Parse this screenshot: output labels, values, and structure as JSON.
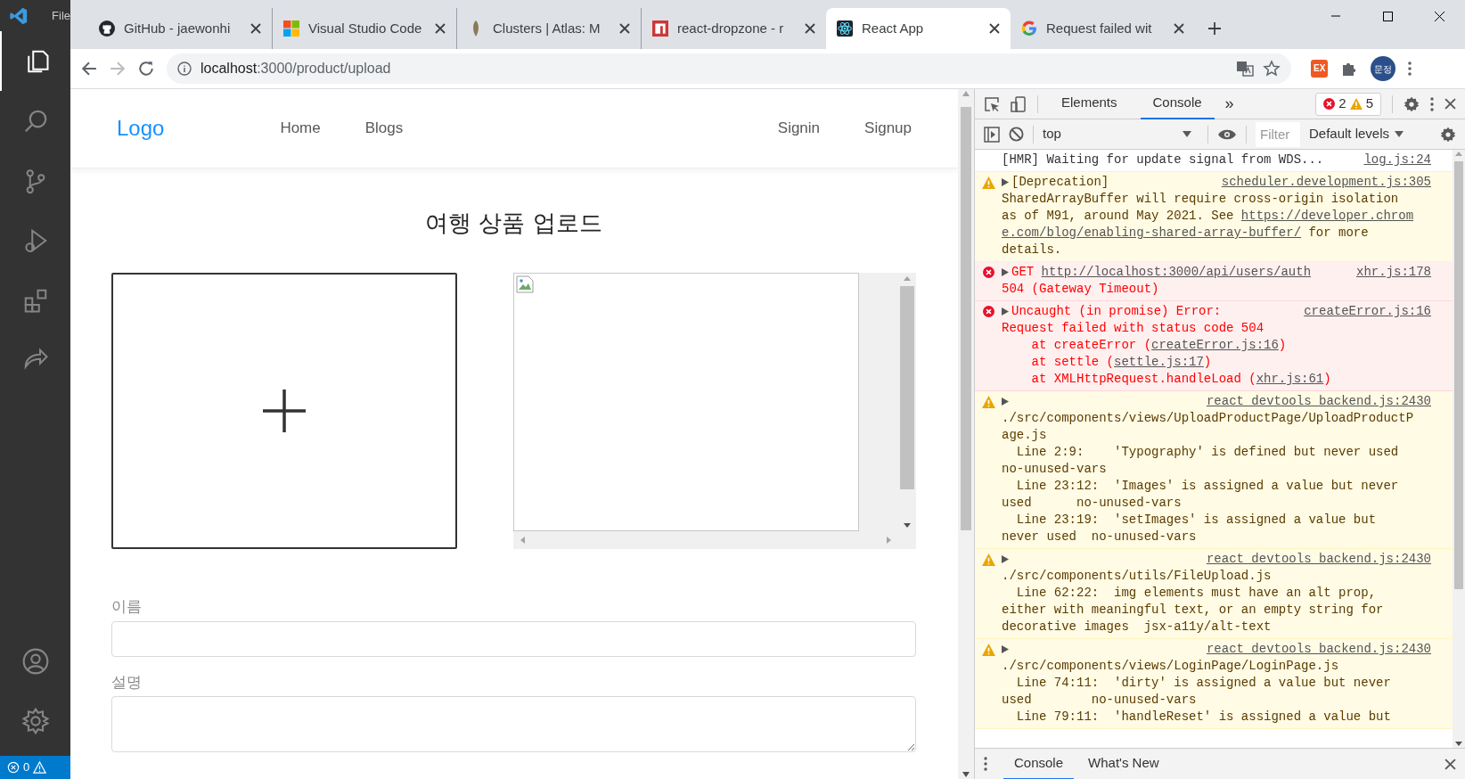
{
  "vscode": {
    "menu_label": "File",
    "status_errors": "0"
  },
  "browser": {
    "tabs": [
      {
        "title": "GitHub - jaewonhi",
        "kind": "github",
        "selected": false
      },
      {
        "title": "Visual Studio Code",
        "kind": "windows",
        "selected": false
      },
      {
        "title": "Clusters | Atlas: M",
        "kind": "leaf",
        "selected": false
      },
      {
        "title": "react-dropzone - r",
        "kind": "npm",
        "selected": false
      },
      {
        "title": "React App",
        "kind": "react",
        "selected": true
      },
      {
        "title": "Request failed wit",
        "kind": "google",
        "selected": false
      }
    ],
    "address_host": "localhost",
    "address_path": ":3000/product/upload",
    "extension_label": "EX",
    "avatar_label": "문정"
  },
  "page": {
    "nav": {
      "logo": "Logo",
      "links": [
        "Home",
        "Blogs"
      ],
      "auth_links": [
        "Signin",
        "Signup"
      ]
    },
    "title": "여행 상품 업로드",
    "fields": [
      {
        "label": "이름",
        "kind": "input"
      },
      {
        "label": "설명",
        "kind": "textarea"
      }
    ]
  },
  "devtools": {
    "tabs": [
      {
        "label": "Elements",
        "selected": false
      },
      {
        "label": "Console",
        "selected": true
      }
    ],
    "more": "»",
    "error_count": "2",
    "warning_count": "5",
    "context": "top",
    "filter_placeholder": "Filter",
    "levels": "Default levels",
    "messages": [
      {
        "kind": "info",
        "expandable": false,
        "source": "log.js:24",
        "head": [
          {
            "text": "[HMR] Waiting for update signal from WDS...",
            "link": false
          }
        ]
      },
      {
        "kind": "warning",
        "expandable": true,
        "source": "scheduler.development.js:305",
        "head": [
          {
            "text": "[Deprecation]",
            "link": false
          }
        ],
        "body": [
          [
            {
              "text": "SharedArrayBuffer will require cross-origin isolation",
              "link": false
            }
          ],
          [
            {
              "text": "as of M91, around May 2021. See ",
              "link": false
            },
            {
              "text": "https://developer.chrom",
              "link": true
            }
          ],
          [
            {
              "text": "e.com/blog/enabling-shared-array-buffer/",
              "link": true
            },
            {
              "text": " for more",
              "link": false
            }
          ],
          [
            {
              "text": "details.",
              "link": false
            }
          ]
        ]
      },
      {
        "kind": "error",
        "expandable": true,
        "source": "xhr.js:178",
        "head": [
          {
            "text": "GET ",
            "link": false
          },
          {
            "text": "http://localhost:3000/api/users/auth",
            "link": true
          }
        ],
        "body": [
          [
            {
              "text": "504 (Gateway Timeout)",
              "link": false
            }
          ]
        ]
      },
      {
        "kind": "error",
        "expandable": true,
        "source": "createError.js:16",
        "head": [
          {
            "text": "Uncaught (in promise) Error:",
            "link": false
          }
        ],
        "body": [
          [
            {
              "text": "Request failed with status code 504",
              "link": false
            }
          ],
          [
            {
              "text": "    at createError (",
              "link": false
            },
            {
              "text": "createError.js:16",
              "link": true
            },
            {
              "text": ")",
              "link": false
            }
          ],
          [
            {
              "text": "    at settle (",
              "link": false
            },
            {
              "text": "settle.js:17",
              "link": true
            },
            {
              "text": ")",
              "link": false
            }
          ],
          [
            {
              "text": "    at XMLHttpRequest.handleLoad (",
              "link": false
            },
            {
              "text": "xhr.js:61",
              "link": true
            },
            {
              "text": ")",
              "link": false
            }
          ]
        ]
      },
      {
        "kind": "warning",
        "expandable": true,
        "source": "react_devtools_backend.js:2430",
        "body": [
          [
            {
              "text": "./src/components/views/UploadProductPage/UploadProductP",
              "link": false
            }
          ],
          [
            {
              "text": "age.js",
              "link": false
            }
          ],
          [
            {
              "text": "  Line 2:9:    'Typography' is defined but never used",
              "link": false
            }
          ],
          [
            {
              "text": "no-unused-vars",
              "link": false
            }
          ],
          [
            {
              "text": "  Line 23:12:  'Images' is assigned a value but never",
              "link": false
            }
          ],
          [
            {
              "text": "used      no-unused-vars",
              "link": false
            }
          ],
          [
            {
              "text": "  Line 23:19:  'setImages' is assigned a value but",
              "link": false
            }
          ],
          [
            {
              "text": "never used  no-unused-vars",
              "link": false
            }
          ]
        ]
      },
      {
        "kind": "warning",
        "expandable": true,
        "source": "react_devtools_backend.js:2430",
        "body": [
          [
            {
              "text": "./src/components/utils/FileUpload.js",
              "link": false
            }
          ],
          [
            {
              "text": "  Line 62:22:  img elements must have an alt prop,",
              "link": false
            }
          ],
          [
            {
              "text": "either with meaningful text, or an empty string for",
              "link": false
            }
          ],
          [
            {
              "text": "decorative images  jsx-a11y/alt-text",
              "link": false
            }
          ]
        ]
      },
      {
        "kind": "warning",
        "expandable": true,
        "source": "react_devtools_backend.js:2430",
        "body": [
          [
            {
              "text": "./src/components/views/LoginPage/LoginPage.js",
              "link": false
            }
          ],
          [
            {
              "text": "  Line 74:11:  'dirty' is assigned a value but never",
              "link": false
            }
          ],
          [
            {
              "text": "used        no-unused-vars",
              "link": false
            }
          ],
          [
            {
              "text": "  Line 79:11:  'handleReset' is assigned a value but",
              "link": false
            }
          ]
        ]
      }
    ],
    "drawer_tabs": [
      {
        "label": "Console",
        "selected": true
      },
      {
        "label": "What's New",
        "selected": false
      }
    ]
  }
}
